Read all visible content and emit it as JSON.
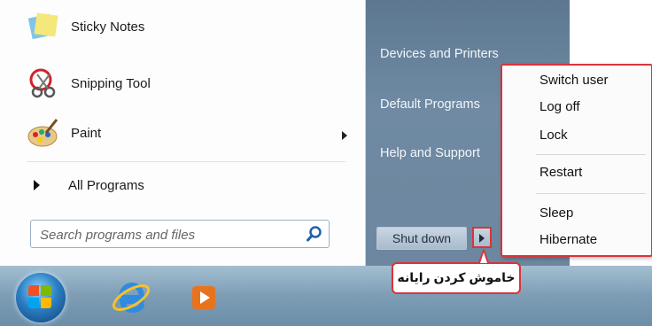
{
  "start_menu": {
    "programs": [
      {
        "label": "Sticky Notes",
        "icon": "sticky-notes-icon"
      },
      {
        "label": "Snipping Tool",
        "icon": "snipping-tool-icon"
      },
      {
        "label": "Paint",
        "icon": "paint-icon"
      }
    ],
    "all_programs_label": "All Programs",
    "search_placeholder": "Search programs and files",
    "right_links": [
      "Devices and Printers",
      "Default Programs",
      "Help and Support"
    ],
    "shutdown_label": "Shut down"
  },
  "shutdown_menu": {
    "items": [
      "Switch user",
      "Log off",
      "Lock",
      "Restart",
      "Sleep",
      "Hibernate"
    ]
  },
  "callout": {
    "text": "خاموش کردن رایانه"
  },
  "taskbar": {
    "icons": [
      "start-orb-icon",
      "internet-explorer-icon",
      "media-player-icon"
    ]
  },
  "colors": {
    "highlight_border": "#d9343a",
    "right_pane": "#6c879f"
  }
}
